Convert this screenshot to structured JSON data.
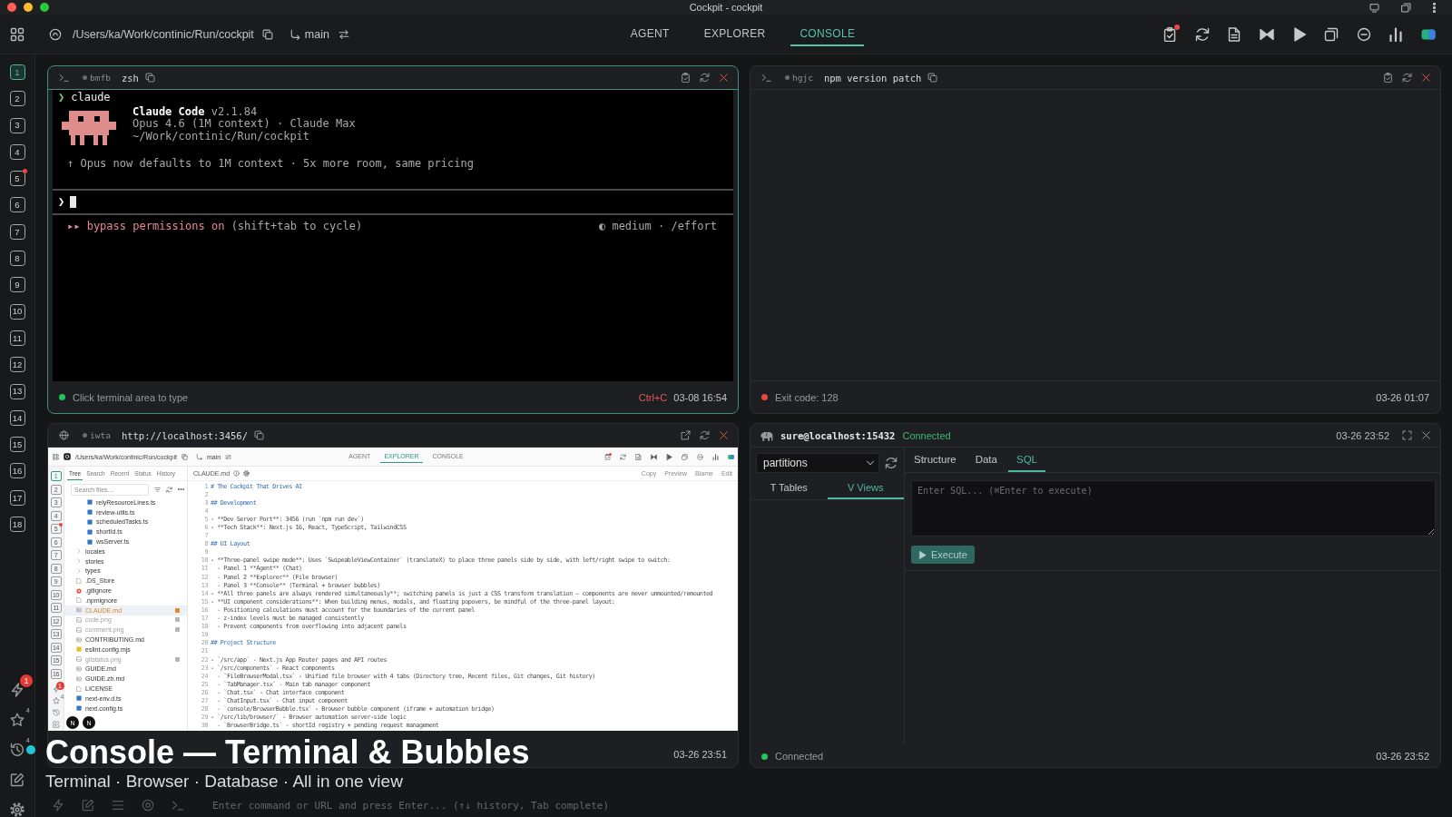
{
  "window": {
    "title": "Cockpit - cockpit"
  },
  "toolbar": {
    "path": "/Users/ka/Work/continic/Run/cockpit",
    "branch": "main",
    "tabs": [
      {
        "label": "AGENT",
        "selected": false
      },
      {
        "label": "EXPLORER",
        "selected": false
      },
      {
        "label": "CONSOLE",
        "selected": true
      }
    ],
    "notification": true
  },
  "sidebar": {
    "items": [
      {
        "label": "1",
        "selected": true,
        "alert": false
      },
      {
        "label": "2",
        "selected": false,
        "alert": false
      },
      {
        "label": "3",
        "selected": false,
        "alert": false
      },
      {
        "label": "4",
        "selected": false,
        "alert": false
      },
      {
        "label": "5",
        "selected": false,
        "alert": true
      },
      {
        "label": "6",
        "selected": false,
        "alert": false
      },
      {
        "label": "7",
        "selected": false,
        "alert": false
      },
      {
        "label": "8",
        "selected": false,
        "alert": false
      },
      {
        "label": "9",
        "selected": false,
        "alert": false
      },
      {
        "label": "10",
        "selected": false,
        "alert": false
      },
      {
        "label": "11",
        "selected": false,
        "alert": false
      },
      {
        "label": "12",
        "selected": false,
        "alert": false
      },
      {
        "label": "13",
        "selected": false,
        "alert": false
      },
      {
        "label": "14",
        "selected": false,
        "alert": false
      },
      {
        "label": "15",
        "selected": false,
        "alert": false
      },
      {
        "label": "16",
        "selected": false,
        "alert": false
      },
      {
        "label": "17",
        "selected": false,
        "alert": false
      },
      {
        "label": "18",
        "selected": false,
        "alert": false
      }
    ],
    "tools": [
      {
        "kind": "bolt",
        "badge": "1"
      },
      {
        "kind": "star",
        "count": "4"
      },
      {
        "kind": "history",
        "count": "4",
        "color": "#22c7d6"
      },
      {
        "kind": "edit"
      },
      {
        "kind": "settings"
      }
    ]
  },
  "panels": [
    {
      "kind": "terminal",
      "active": true,
      "session": "bmfb",
      "title": "zsh",
      "screen": {
        "prompt": "❯",
        "command": "claude",
        "banner_title": "Claude Code",
        "banner_version": "v2.1.84",
        "banner_lines": [
          "Opus 4.6 (1M context) · Claude Max",
          "~/Work/continic/Run/cockpit"
        ],
        "notice": "↑ Opus now defaults to 1M context · 5x more room, same pricing",
        "input_prompt": "❯",
        "mode_arrows": "▸▸",
        "mode_label": "bypass permissions on",
        "mode_hint": "(shift+tab to cycle)",
        "effort": "◐ medium · /effort"
      },
      "status": {
        "text": "Click terminal area to type",
        "color": "#22c55e"
      },
      "interrupt": "Ctrl+C",
      "time": "03-08 16:54"
    },
    {
      "kind": "terminal",
      "active": false,
      "session": "hgjc",
      "title": "npm version patch",
      "status": {
        "text": "Exit code: 128",
        "color": "#ef4444"
      },
      "time": "03-26 01:07"
    },
    {
      "kind": "browser",
      "active": false,
      "session": "iwta",
      "url": "http://localhost:3456/",
      "page": {
        "path": "/Users/ka/Work/continic/Run/cockpit",
        "branch": "main",
        "tabs": [
          {
            "label": "AGENT",
            "selected": false
          },
          {
            "label": "EXPLORER",
            "selected": true
          },
          {
            "label": "CONSOLE",
            "selected": false
          }
        ],
        "notification": true,
        "slots": [
          {
            "label": "1",
            "selected": true,
            "alert": false
          },
          {
            "label": "2",
            "selected": false,
            "alert": false
          },
          {
            "label": "3",
            "selected": false,
            "alert": false
          },
          {
            "label": "4",
            "selected": false,
            "alert": false
          },
          {
            "label": "5",
            "selected": false,
            "alert": true
          },
          {
            "label": "6",
            "selected": false,
            "alert": false
          },
          {
            "label": "7",
            "selected": false,
            "alert": false
          },
          {
            "label": "8",
            "selected": false,
            "alert": false
          },
          {
            "label": "9",
            "selected": false,
            "alert": false
          },
          {
            "label": "10",
            "selected": false,
            "alert": false
          },
          {
            "label": "11",
            "selected": false,
            "alert": false
          },
          {
            "label": "12",
            "selected": false,
            "alert": false
          },
          {
            "label": "13",
            "selected": false,
            "alert": false
          },
          {
            "label": "14",
            "selected": false,
            "alert": false
          },
          {
            "label": "15",
            "selected": false,
            "alert": false
          },
          {
            "label": "16",
            "selected": false,
            "alert": false
          }
        ],
        "tools": [
          {
            "kind": "bolt",
            "badge": "1"
          },
          {
            "kind": "star",
            "count": "4"
          },
          {
            "kind": "history"
          },
          {
            "kind": "edit"
          }
        ],
        "file_tabs": [
          {
            "label": "Tree",
            "selected": true
          },
          {
            "label": "Search",
            "selected": false
          },
          {
            "label": "Recent",
            "selected": false
          },
          {
            "label": "Status",
            "selected": false
          },
          {
            "label": "History",
            "selected": false
          }
        ],
        "search_placeholder": "Search files...",
        "folder_tail": [
          {
            "name": "relyResourceLines.ts",
            "kind": "ts",
            "selected": false,
            "ignored": false
          },
          {
            "name": "review-utils.ts",
            "kind": "ts",
            "selected": false,
            "ignored": false
          },
          {
            "name": "scheduledTasks.ts",
            "kind": "ts",
            "selected": false,
            "ignored": false
          },
          {
            "name": "shortId.ts",
            "kind": "ts",
            "selected": false,
            "ignored": false
          },
          {
            "name": "wsServer.ts",
            "kind": "ts",
            "selected": false,
            "ignored": false
          }
        ],
        "files": [
          {
            "name": "locales",
            "kind": "folder",
            "selected": false,
            "ignored": false
          },
          {
            "name": "stories",
            "kind": "folder",
            "selected": false,
            "ignored": false
          },
          {
            "name": "types",
            "kind": "folder",
            "selected": false,
            "ignored": false
          },
          {
            "name": ".DS_Store",
            "kind": "file",
            "selected": false,
            "ignored": false
          },
          {
            "name": ".gitignore",
            "kind": "gitignore",
            "selected": false,
            "ignored": false
          },
          {
            "name": ".npmignore",
            "kind": "file",
            "selected": false,
            "ignored": false
          },
          {
            "name": "CLAUDE.md",
            "kind": "md",
            "selected": true,
            "ignored": false,
            "color": "#e08a2c"
          },
          {
            "name": "code.png",
            "kind": "image",
            "selected": false,
            "ignored": true,
            "color": "#b5b5b5"
          },
          {
            "name": "comment.png",
            "kind": "image",
            "selected": false,
            "ignored": true,
            "color": "#b5b5b5"
          },
          {
            "name": "CONTRIBUTING.md",
            "kind": "md",
            "selected": false,
            "ignored": false
          },
          {
            "name": "eslint.config.mjs",
            "kind": "config",
            "selected": false,
            "ignored": false
          },
          {
            "name": "gitstatus.png",
            "kind": "image",
            "selected": false,
            "ignored": true,
            "color": "#b5b5b5"
          },
          {
            "name": "GUIDE.md",
            "kind": "md",
            "selected": false,
            "ignored": false
          },
          {
            "name": "GUIDE.zh.md",
            "kind": "md",
            "selected": false,
            "ignored": false
          },
          {
            "name": "LICENSE",
            "kind": "file",
            "selected": false,
            "ignored": false
          },
          {
            "name": "next-env.d.ts",
            "kind": "ts",
            "selected": false,
            "ignored": false
          },
          {
            "name": "next.config.ts",
            "kind": "ts",
            "selected": false,
            "ignored": false
          }
        ],
        "editor": {
          "file": "CLAUDE.md",
          "actions": [
            "Copy",
            "Preview",
            "Blame",
            "Edit"
          ],
          "lines": [
            {
              "n": "1",
              "kind": "heading",
              "text": "# The Cockpit That Drives AI"
            },
            {
              "n": "2"
            },
            {
              "n": "3",
              "kind": "heading",
              "text": "## Development"
            },
            {
              "n": "4"
            },
            {
              "n": "5",
              "kind": "text",
              "text": "- **Dev Server Port**: 3456 (run `npm run dev`)"
            },
            {
              "n": "6",
              "kind": "text",
              "text": "- **Tech Stack**: Next.js 16, React, TypeScript, TailwindCSS"
            },
            {
              "n": "7"
            },
            {
              "n": "8",
              "kind": "heading",
              "text": "## UI Layout"
            },
            {
              "n": "9"
            },
            {
              "n": "10",
              "kind": "text",
              "text": "- **Three-panel swipe mode**: Uses `SwipeableViewContainer` (translateX) to place three panels side by side, with left/right swipe to switch:"
            },
            {
              "n": "11",
              "kind": "text",
              "text": "  - Panel 1 **Agent** (Chat)"
            },
            {
              "n": "12",
              "kind": "text",
              "text": "  - Panel 2 **Explorer** (File browser)"
            },
            {
              "n": "13",
              "kind": "text",
              "text": "  - Panel 3 **Console** (Terminal + browser bubbles)"
            },
            {
              "n": "14",
              "kind": "text",
              "text": "- **All three panels are always rendered simultaneously**; switching panels is just a CSS transform translation — components are never unmounted/remounted"
            },
            {
              "n": "15",
              "kind": "text",
              "text": "- **UI component considerations**: When building menus, modals, and floating popovers, be mindful of the three-panel layout:"
            },
            {
              "n": "16",
              "kind": "text",
              "text": "  - Positioning calculations must account for the boundaries of the current panel"
            },
            {
              "n": "17",
              "kind": "text",
              "text": "  - z-index levels must be managed consistently"
            },
            {
              "n": "18",
              "kind": "text",
              "text": "  - Prevent components from overflowing into adjacent panels"
            },
            {
              "n": "19"
            },
            {
              "n": "20",
              "kind": "heading",
              "text": "## Project Structure"
            },
            {
              "n": "21"
            },
            {
              "n": "22",
              "kind": "text",
              "text": "- `/src/app` - Next.js App Router pages and API routes"
            },
            {
              "n": "23",
              "kind": "text",
              "text": "- `/src/components` - React components"
            },
            {
              "n": "24",
              "kind": "text",
              "text": "  - `FileBrowserModal.tsx` - Unified file browser with 4 tabs (Directory tree, Recent files, Git changes, Git history)"
            },
            {
              "n": "25",
              "kind": "text",
              "text": "  - `TabManager.tsx` - Main tab manager component"
            },
            {
              "n": "26",
              "kind": "text",
              "text": "  - `Chat.tsx` - Chat interface component"
            },
            {
              "n": "27",
              "kind": "text",
              "text": "  - `ChatInput.tsx` - Chat input component"
            },
            {
              "n": "28",
              "kind": "text",
              "text": "  - `console/BrowserBubble.tsx` - Browser bubble component (iframe + automation bridge)"
            },
            {
              "n": "29",
              "kind": "text",
              "text": "- `/src/lib/browser/` - Browser automation server-side logic"
            },
            {
              "n": "30",
              "kind": "text",
              "text": "  - `BrowserBridge.ts` - shortId registry + pending request management"
            }
          ]
        },
        "dev_badges": [
          "N",
          "N"
        ]
      },
      "time": "03-26 23:51"
    },
    {
      "kind": "database",
      "active": false,
      "connection": "sure@localhost:15432",
      "connection_state": "Connected",
      "header_time": "03-26 23:52",
      "database": "partitions",
      "list_tabs": [
        {
          "label": "T Tables",
          "selected": false
        },
        {
          "label": "V Views",
          "selected": true
        }
      ],
      "query_tabs": [
        {
          "label": "Structure",
          "selected": false
        },
        {
          "label": "Data",
          "selected": false
        },
        {
          "label": "SQL",
          "selected": true
        }
      ],
      "sql_placeholder": "Enter SQL... (⌘Enter to execute)",
      "execute": {
        "label": "Execute",
        "disabled": true
      },
      "status": {
        "text": "Connected",
        "color": "#22c55e"
      },
      "time": "03-26 23:52"
    }
  ],
  "caption": {
    "title": "Console — Terminal & Bubbles",
    "subtitle": "Terminal · Browser · Database · All in one view"
  },
  "command_bar": {
    "placeholder": "Enter command or URL and press Enter... (↑↓ history, Tab complete)"
  }
}
